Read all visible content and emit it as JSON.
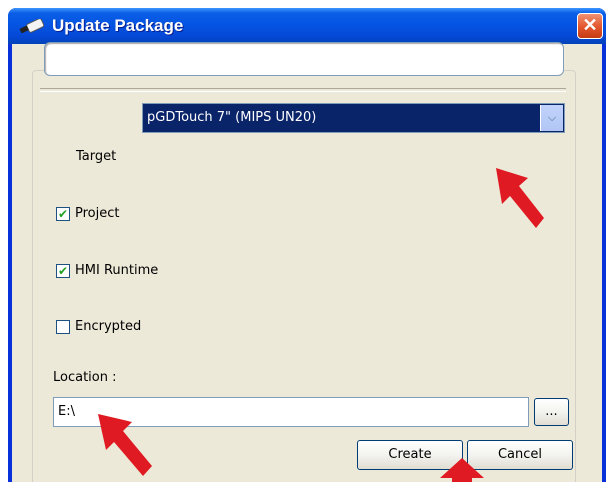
{
  "window": {
    "title": "Update Package",
    "close_glyph": "✕"
  },
  "name_field": {
    "value": ""
  },
  "target": {
    "label": "Target",
    "selected": "pGDTouch 7\" (MIPS UN20)",
    "arrow_glyph": "⌵"
  },
  "options": [
    {
      "label": "Project",
      "checked": true
    },
    {
      "label": "HMI Runtime",
      "checked": true
    },
    {
      "label": "Encrypted",
      "checked": false
    }
  ],
  "location": {
    "label": "Location :",
    "value": "E:\\",
    "browse_label": "..."
  },
  "buttons": {
    "create": "Create",
    "cancel": "Cancel"
  },
  "check_glyph": "✔",
  "colors": {
    "titlebar": "#0554e3",
    "dialog_bg": "#ece9d8",
    "selection": "#0a246a",
    "annotation_arrow": "#e01a22"
  }
}
